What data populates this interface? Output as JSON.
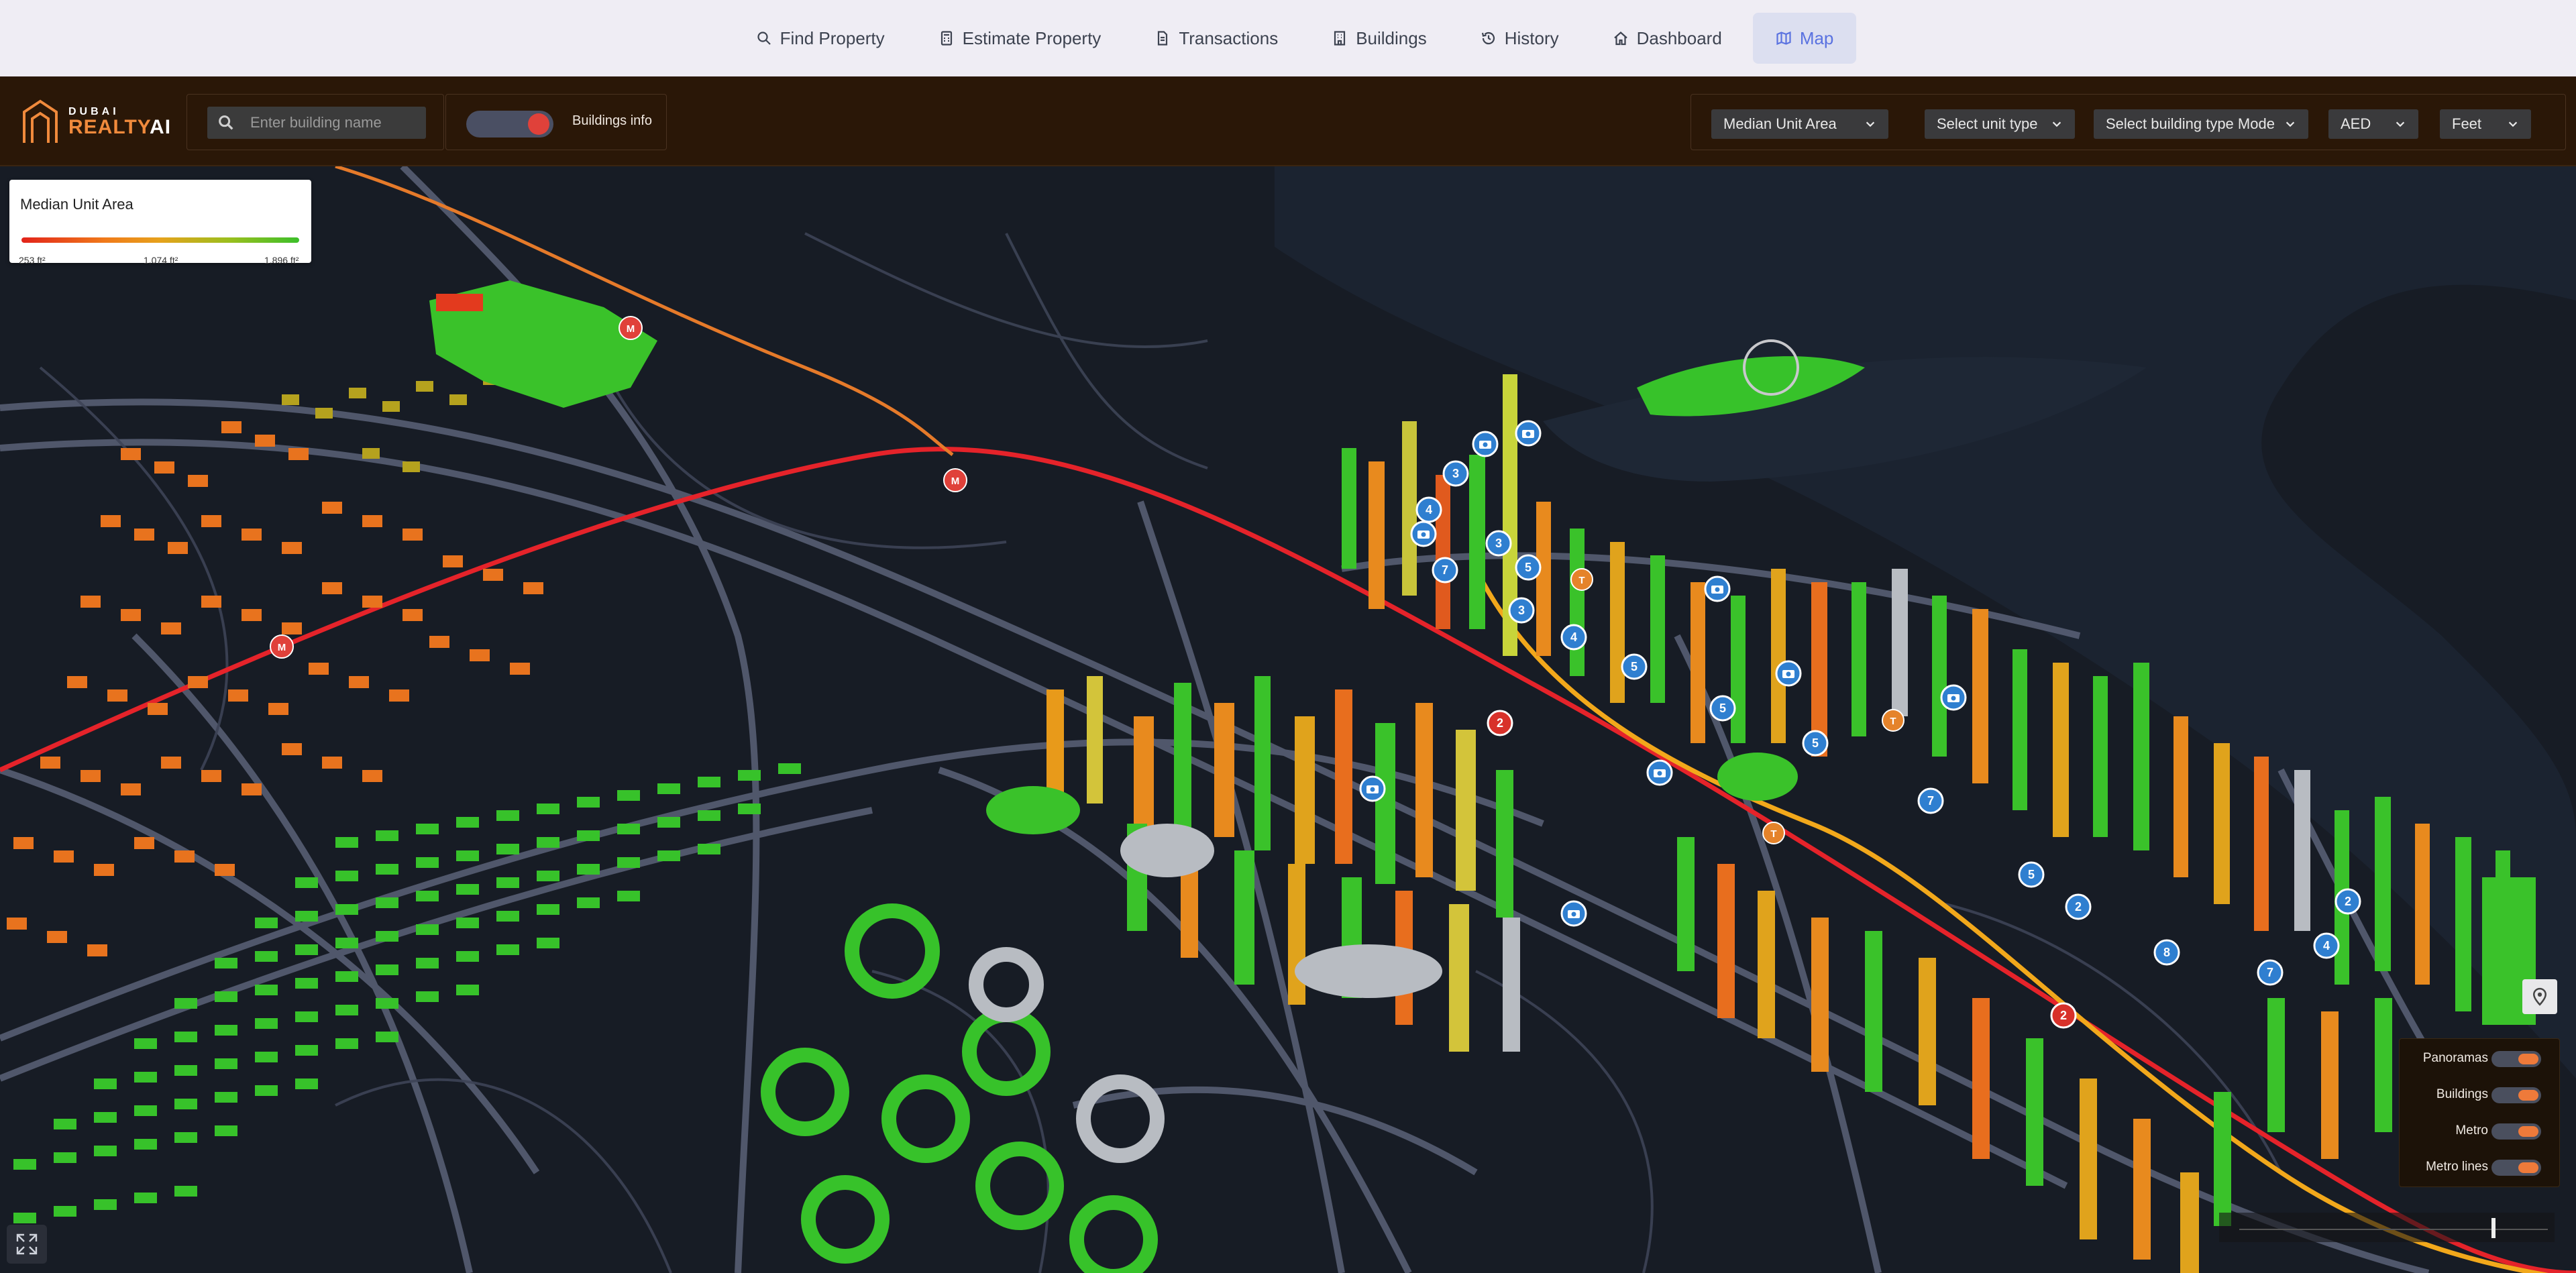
{
  "nav": {
    "items": [
      {
        "label": "Find Property",
        "icon": "search-icon"
      },
      {
        "label": "Estimate Property",
        "icon": "calculator-icon"
      },
      {
        "label": "Transactions",
        "icon": "document-icon"
      },
      {
        "label": "Buildings",
        "icon": "building-icon"
      },
      {
        "label": "History",
        "icon": "history-icon"
      },
      {
        "label": "Dashboard",
        "icon": "home-icon"
      },
      {
        "label": "Map",
        "icon": "map-icon",
        "active": true
      }
    ]
  },
  "logo": {
    "top": "DUBAI",
    "main": "REALTY",
    "suffix": "AI"
  },
  "search": {
    "placeholder": "Enter building name"
  },
  "buildings_toggle": {
    "label": "Buildings info",
    "on": true
  },
  "filters": {
    "metric": "Median Unit Area",
    "unit_type": "Select unit type",
    "building_type": "Select building type Mode",
    "currency": "AED",
    "units": "Feet"
  },
  "legend": {
    "title": "Median Unit Area",
    "min": "253 ft²",
    "mid": "1,074 ft²",
    "max": "1,896 ft²"
  },
  "layers": {
    "items": [
      {
        "label": "Panoramas",
        "on": true
      },
      {
        "label": "Buildings",
        "on": true
      },
      {
        "label": "Metro",
        "on": true
      },
      {
        "label": "Metro lines",
        "on": true
      }
    ]
  },
  "map_markers": {
    "metro_label": "M",
    "tram_label": "T",
    "clusters": [
      "3",
      "4",
      "3",
      "7",
      "5",
      "3",
      "4",
      "5",
      "5",
      "5",
      "7",
      "5",
      "2",
      "8",
      "7",
      "2",
      "4"
    ],
    "red_clusters": [
      "2",
      "2"
    ]
  },
  "colors": {
    "accent": "#5a72e0",
    "toolbar": "#2a1707",
    "low": "#e2231a",
    "mid": "#e6a21c",
    "high": "#3cbf2a",
    "panel_toggle": "#ee7a3a"
  }
}
